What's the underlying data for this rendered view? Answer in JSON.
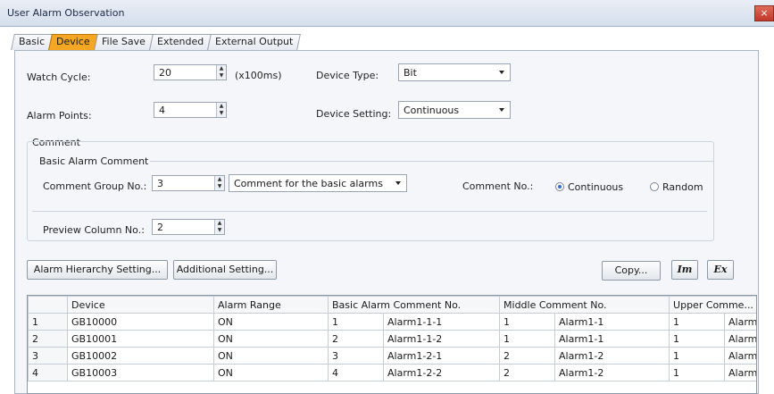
{
  "window": {
    "title": "User Alarm Observation",
    "close_glyph": "×"
  },
  "tabs": [
    "Basic",
    "Device",
    "File Save",
    "Extended",
    "External Output"
  ],
  "form": {
    "watch_cycle_label": "Watch Cycle:",
    "watch_cycle_value": "20",
    "watch_cycle_unit": "(x100ms)",
    "device_type_label": "Device Type:",
    "device_type_value": "Bit",
    "alarm_points_label": "Alarm Points:",
    "alarm_points_value": "4",
    "device_setting_label": "Device Setting:",
    "device_setting_value": "Continuous"
  },
  "comment": {
    "group_label": "Comment",
    "basic_label": "Basic Alarm Comment",
    "group_no_label": "Comment Group No.:",
    "group_no_value": "3",
    "group_select_value": "Comment for the basic alarms",
    "comment_no_label": "Comment No.:",
    "radio_continuous": "Continuous",
    "radio_random": "Random",
    "preview_label": "Preview Column No.:",
    "preview_value": "2"
  },
  "buttons": {
    "hierarchy": "Alarm Hierarchy Setting...",
    "additional": "Additional Setting...",
    "copy": "Copy...",
    "import": "Im",
    "export": "Ex"
  },
  "table": {
    "headers": [
      "",
      "Device",
      "Alarm Range",
      "Basic Alarm Comment No.",
      "Middle Comment No.",
      "Upper Comme..."
    ],
    "rows": [
      [
        "1",
        "GB10000",
        "ON",
        "1",
        "Alarm1-1-1",
        "1",
        "Alarm1-1",
        "1",
        "Alarm"
      ],
      [
        "2",
        "GB10001",
        "ON",
        "2",
        "Alarm1-1-2",
        "1",
        "Alarm1-1",
        "1",
        "Alarm"
      ],
      [
        "3",
        "GB10002",
        "ON",
        "3",
        "Alarm1-2-1",
        "2",
        "Alarm1-2",
        "1",
        "Alarm"
      ],
      [
        "4",
        "GB10003",
        "ON",
        "4",
        "Alarm1-2-2",
        "2",
        "Alarm1-2",
        "1",
        "Alarm"
      ]
    ]
  }
}
